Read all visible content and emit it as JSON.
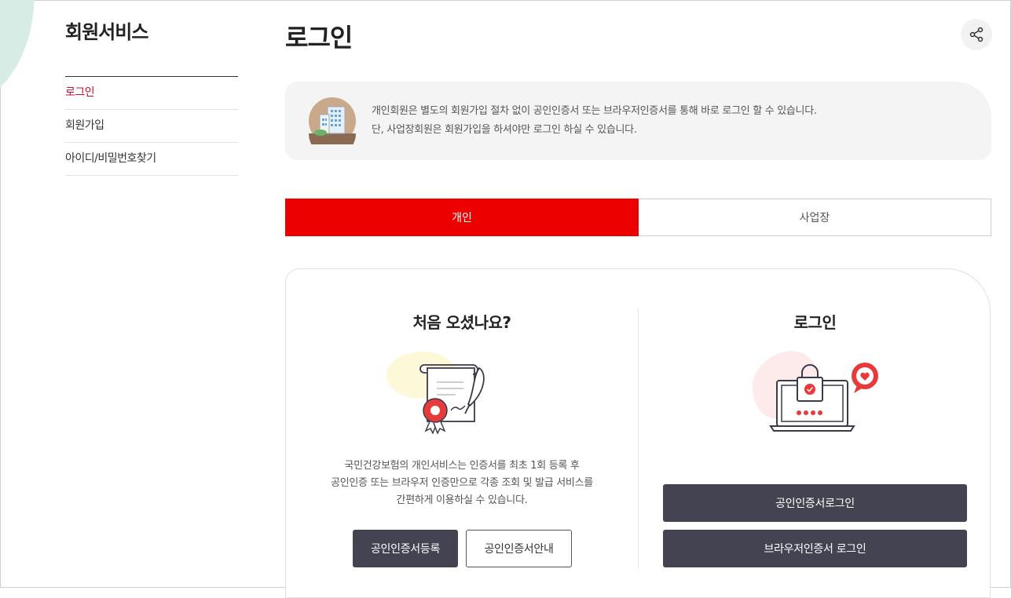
{
  "sidebar": {
    "title": "회원서비스",
    "items": [
      {
        "label": "로그인"
      },
      {
        "label": "회원가입"
      },
      {
        "label": "아이디/비밀번호찾기"
      }
    ]
  },
  "page": {
    "title": "로그인"
  },
  "notice": {
    "line1": "개인회원은 별도의 회원가입 절차 없이 공인인증서 또는 브라우저인증서를 통해 바로 로그인 할 수 있습니다.",
    "line2": "단, 사업장회원은 회원가입을 하셔야만 로그인 하실 수 있습니다."
  },
  "tabs": [
    {
      "label": "개인"
    },
    {
      "label": "사업장"
    }
  ],
  "first_visit": {
    "title": "처음 오셨나요?",
    "desc_line1": "국민건강보험의 개인서비스는 인증서를 최초 1회 등록 후",
    "desc_line2": "공인인증 또는 브라우저 인증만으로 각종 조회 및 발급 서비스를",
    "desc_line3": "간편하게 이용하실 수 있습니다.",
    "register_button": "공인인증서등록",
    "guide_button": "공인인증서안내"
  },
  "login": {
    "title": "로그인",
    "cert_login_button": "공인인증서로그인",
    "browser_login_button": "브라우저인증서 로그인"
  },
  "colors": {
    "accent_red": "#ec0000",
    "dark_button": "#434352"
  },
  "icons": {
    "share": "share-icon",
    "building": "building-icon",
    "certificate": "certificate-icon",
    "laptop_lock": "laptop-lock-icon"
  }
}
